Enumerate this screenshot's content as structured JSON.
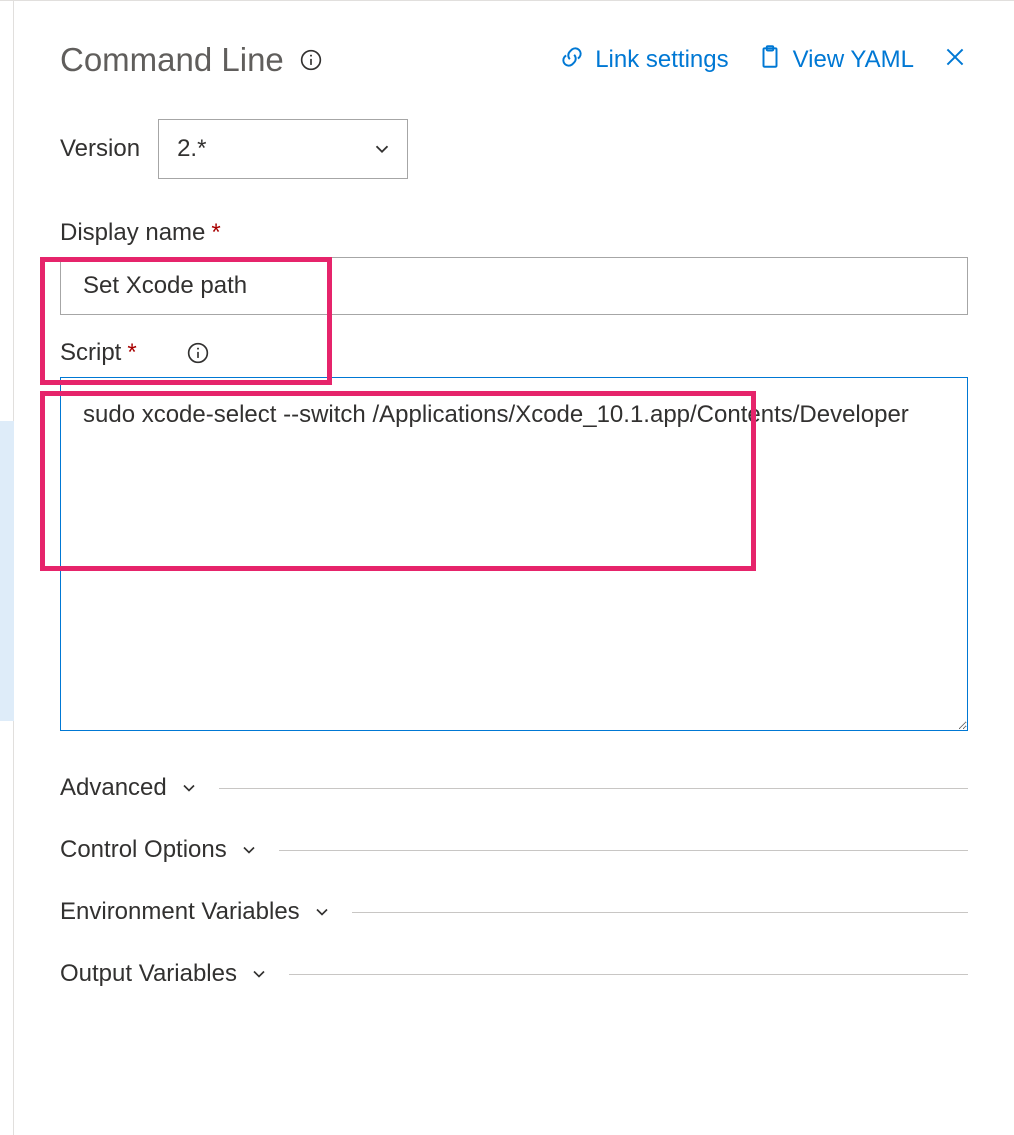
{
  "header": {
    "title": "Command Line",
    "link_settings_label": "Link settings",
    "view_yaml_label": "View YAML"
  },
  "version": {
    "label": "Version",
    "value": "2.*"
  },
  "fields": {
    "display_name": {
      "label": "Display name",
      "required_mark": "*",
      "value": "Set Xcode path"
    },
    "script": {
      "label": "Script",
      "required_mark": "*",
      "value": "sudo xcode-select --switch /Applications/Xcode_10.1.app/Contents/Developer"
    }
  },
  "sections": {
    "advanced": "Advanced",
    "control_options": "Control Options",
    "environment_variables": "Environment Variables",
    "output_variables": "Output Variables"
  }
}
